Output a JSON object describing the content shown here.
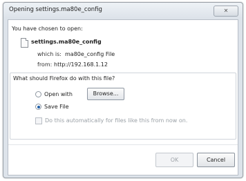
{
  "window": {
    "title": "Opening settings.ma80e_config",
    "close_label": "✕"
  },
  "dialog": {
    "chosen_label": "You have chosen to open:",
    "filename": "settings.ma80e_config",
    "which_label": "which is:",
    "which_value": "ma80e_config File",
    "from_label": "from:",
    "from_value": "http://192.168.1.12"
  },
  "group": {
    "label": "What should Firefox do with this file?",
    "open_with": "Open with",
    "browse": "Browse...",
    "save_file": "Save File",
    "selected": "save_file",
    "auto_label": "Do this automatically for files like this from now on.",
    "auto_checked": false,
    "auto_enabled": false
  },
  "buttons": {
    "ok": "OK",
    "ok_enabled": false,
    "cancel": "Cancel"
  },
  "icons": {
    "file": "file-icon",
    "close": "close-icon"
  }
}
